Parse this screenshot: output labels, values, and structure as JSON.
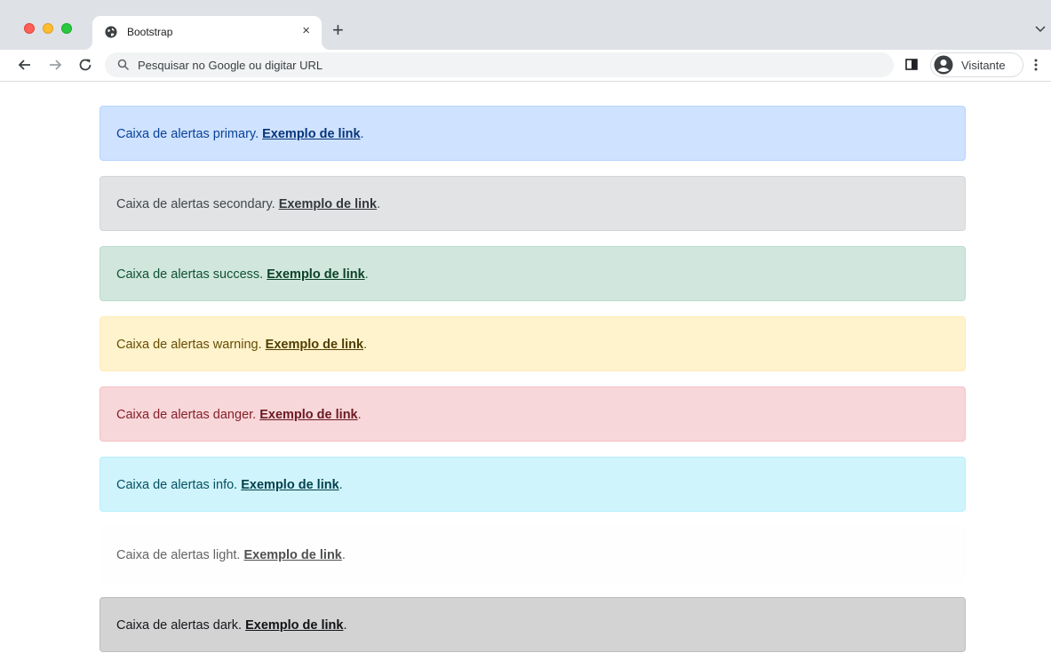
{
  "browser": {
    "tab": {
      "title": "Bootstrap",
      "close": "×"
    },
    "new_tab": "+",
    "omnibox": {
      "placeholder": "Pesquisar no Google ou digitar URL"
    },
    "profile": {
      "label": "Visitante"
    }
  },
  "alerts": [
    {
      "text": "Caixa de alertas primary. ",
      "link": "Exemplo de link",
      "end": ".",
      "bg": "#cfe2ff",
      "border": "#b6d4fe",
      "color": "#084298",
      "link_color": "#06357a"
    },
    {
      "text": "Caixa de alertas secondary. ",
      "link": "Exemplo de link",
      "end": ".",
      "bg": "#e2e3e5",
      "border": "#d3d6d8",
      "color": "#41464b",
      "link_color": "#34383c"
    },
    {
      "text": "Caixa de alertas success. ",
      "link": "Exemplo de link",
      "end": ".",
      "bg": "#d1e7dd",
      "border": "#badbcc",
      "color": "#0f5132",
      "link_color": "#0c4128"
    },
    {
      "text": "Caixa de alertas warning. ",
      "link": "Exemplo de link",
      "end": ".",
      "bg": "#fff3cd",
      "border": "#ffecb5",
      "color": "#664d03",
      "link_color": "#523e02"
    },
    {
      "text": "Caixa de alertas danger. ",
      "link": "Exemplo de link",
      "end": ".",
      "bg": "#f8d7da",
      "border": "#f5c2c7",
      "color": "#842029",
      "link_color": "#6a1a21"
    },
    {
      "text": "Caixa de alertas info. ",
      "link": "Exemplo de link",
      "end": ".",
      "bg": "#cff4fc",
      "border": "#b6effb",
      "color": "#055160",
      "link_color": "#04414d"
    },
    {
      "text": "Caixa de alertas light. ",
      "link": "Exemplo de link",
      "end": ".",
      "bg": "#fefefe",
      "border": "#fdfdfe",
      "color": "#636464",
      "link_color": "#4f5050"
    },
    {
      "text": "Caixa de alertas dark. ",
      "link": "Exemplo de link",
      "end": ".",
      "bg": "#d3d3d4",
      "border": "#bcbebf",
      "color": "#141619",
      "link_color": "#101214"
    }
  ]
}
